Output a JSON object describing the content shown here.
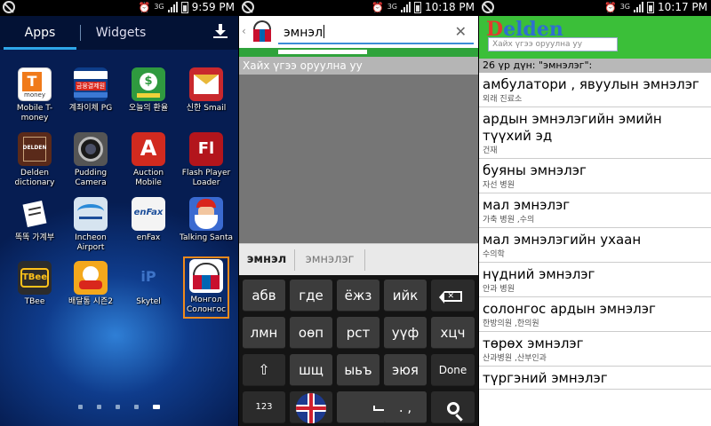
{
  "status_bars": [
    {
      "net": "3G",
      "time": "9:59 PM"
    },
    {
      "net": "3G",
      "time": "10:18 PM"
    },
    {
      "net": "3G",
      "time": "10:17 PM"
    }
  ],
  "launcher": {
    "tabs": {
      "apps": "Apps",
      "widgets": "Widgets"
    },
    "apps": [
      {
        "label": "Mobile T-money",
        "icon": "tmoney-icon",
        "glyph": "T money"
      },
      {
        "label": "계좌이체 PG",
        "icon": "bank-transfer-icon",
        "glyph": "금융결제원"
      },
      {
        "label": "오늘의 환율",
        "icon": "exchange-rate-icon",
        "glyph": "$"
      },
      {
        "label": "신한 Smail",
        "icon": "shinhan-smail-icon",
        "glyph": ""
      },
      {
        "label": "Delden dictionary",
        "icon": "delden-icon",
        "glyph": "DELDEN"
      },
      {
        "label": "Pudding Camera",
        "icon": "camera-icon",
        "glyph": ""
      },
      {
        "label": "Auction Mobile",
        "icon": "auction-icon",
        "glyph": "A"
      },
      {
        "label": "Flash Player Loader",
        "icon": "flash-icon",
        "glyph": "Fl"
      },
      {
        "label": "똑똑 가계부",
        "icon": "ledger-icon",
        "glyph": ""
      },
      {
        "label": "Incheon Airport",
        "icon": "airport-icon",
        "glyph": ""
      },
      {
        "label": "enFax",
        "icon": "enfax-icon",
        "glyph": "enFax"
      },
      {
        "label": "Talking Santa",
        "icon": "santa-icon",
        "glyph": ""
      },
      {
        "label": "TBee",
        "icon": "tbee-icon",
        "glyph": "TBee"
      },
      {
        "label": "배달통 시즌2",
        "icon": "delivery-icon",
        "glyph": ""
      },
      {
        "label": "Skytel",
        "icon": "skytel-icon",
        "glyph": "iP"
      },
      {
        "label": "Монгол Солонгос",
        "icon": "mongol-dict-icon",
        "glyph": ""
      }
    ]
  },
  "search_screen": {
    "query": "эмнэл",
    "hint": "Хайх үгээ оруулна уу",
    "suggestions": [
      "эмнэл",
      "эмнэлэг"
    ],
    "keys": {
      "row1": [
        "абв",
        "где",
        "ёжз",
        "ийк"
      ],
      "row2": [
        "лмн",
        "оөп",
        "рст",
        "уүф",
        "хцч"
      ],
      "row3": [
        "шщ",
        "ыьъ",
        "эюя"
      ],
      "done": "Done",
      "num": "123",
      "punct": ". ,"
    }
  },
  "results_screen": {
    "logo": "Delden",
    "search_placeholder": "Хайх үгээ оруулна уу",
    "result_header": "26 үр дүн: \"эмнэлэг\":",
    "results": [
      {
        "mn": "амбулатори , явуулын эмнэлэг",
        "ko": "외래 진료소"
      },
      {
        "mn": "ардын эмнэлэгийн эмийн түүхий эд",
        "ko": "건재"
      },
      {
        "mn": "буяны эмнэлэг",
        "ko": "자선 병원"
      },
      {
        "mn": "мал эмнэлэг",
        "ko": "가축 병원 ,수의"
      },
      {
        "mn": "мал эмнэлэгийн ухаан",
        "ko": "수의학"
      },
      {
        "mn": "нүдний эмнэлэг",
        "ko": "안과 병원"
      },
      {
        "mn": "солонгос ардын эмнэлэг",
        "ko": "한방의원 ,한의원"
      },
      {
        "mn": "төрөх эмнэлэг",
        "ko": "산과병원 ,산부인과"
      },
      {
        "mn": "түргэний эмнэлэг",
        "ko": ""
      }
    ]
  }
}
